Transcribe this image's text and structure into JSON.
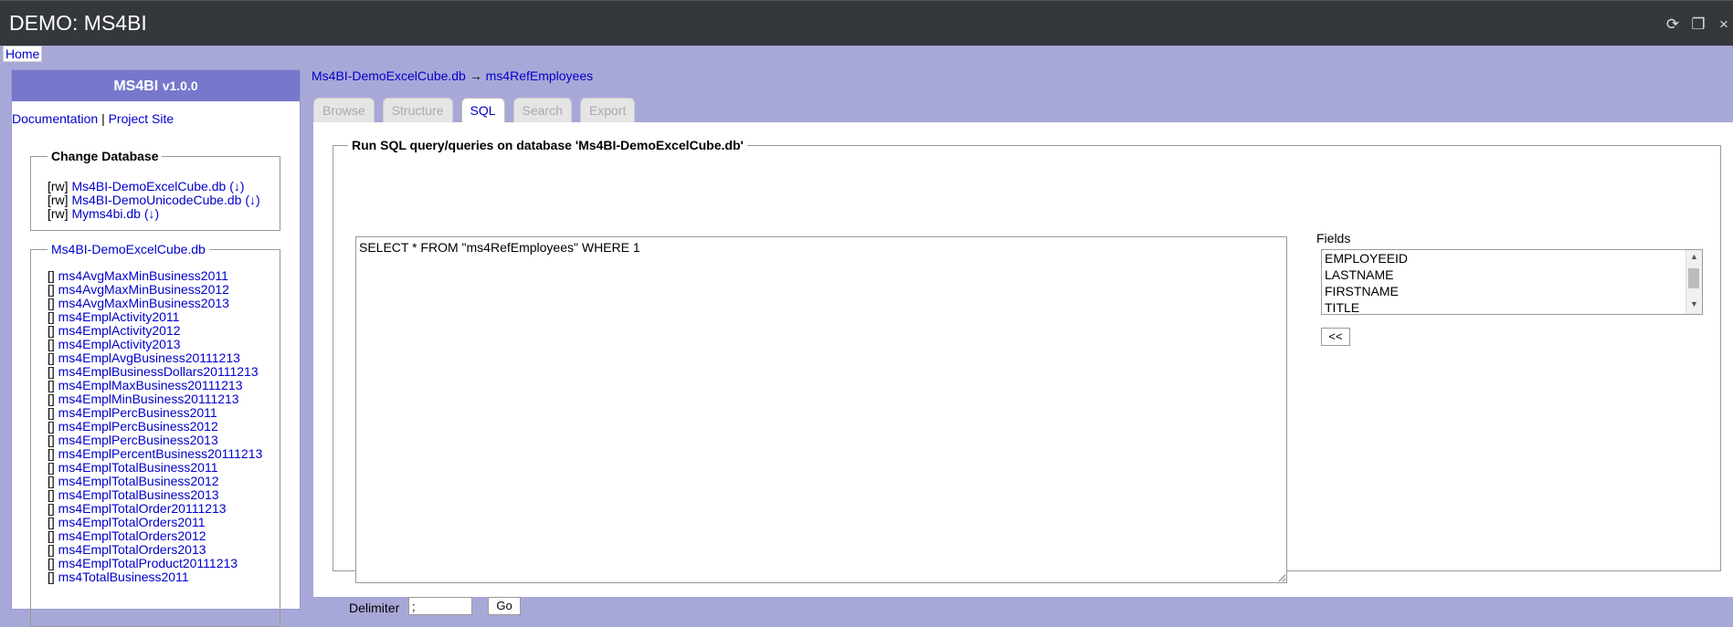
{
  "app": {
    "title": "DEMO: MS4BI",
    "home_label": "Home"
  },
  "sidebar": {
    "title": "MS4BI",
    "version": "v1.0.0",
    "doc_link": "Documentation",
    "separator": "|",
    "project_link": "Project Site",
    "change_db_legend": "Change Database",
    "databases": [
      {
        "mode": "[rw]",
        "name": "Ms4BI-DemoExcelCube.db",
        "download": "(↓)"
      },
      {
        "mode": "[rw]",
        "name": "Ms4BI-DemoUnicodeCube.db",
        "download": "(↓)"
      },
      {
        "mode": "[rw]",
        "name": "Myms4bi.db",
        "download": "(↓)"
      }
    ],
    "current_db": "Ms4BI-DemoExcelCube.db",
    "table_prefix": "[]",
    "tables": [
      "ms4AvgMaxMinBusiness2011",
      "ms4AvgMaxMinBusiness2012",
      "ms4AvgMaxMinBusiness2013",
      "ms4EmplActivity2011",
      "ms4EmplActivity2012",
      "ms4EmplActivity2013",
      "ms4EmplAvgBusiness20111213",
      "ms4EmplBusinessDollars20111213",
      "ms4EmplMaxBusiness20111213",
      "ms4EmplMinBusiness20111213",
      "ms4EmplPercBusiness2011",
      "ms4EmplPercBusiness2012",
      "ms4EmplPercBusiness2013",
      "ms4EmplPercentBusiness20111213",
      "ms4EmplTotalBusiness2011",
      "ms4EmplTotalBusiness2012",
      "ms4EmplTotalBusiness2013",
      "ms4EmplTotalOrder20111213",
      "ms4EmplTotalOrders2011",
      "ms4EmplTotalOrders2012",
      "ms4EmplTotalOrders2013",
      "ms4EmplTotalProduct20111213",
      "ms4TotalBusiness2011"
    ]
  },
  "main": {
    "breadcrumb_db": "Ms4BI-DemoExcelCube.db",
    "breadcrumb_arrow": "→",
    "breadcrumb_table": "ms4RefEmployees",
    "tabs": [
      "Browse",
      "Structure",
      "SQL",
      "Search",
      "Export"
    ],
    "active_tab": "SQL",
    "query_legend": "Run SQL query/queries on database 'Ms4BI-DemoExcelCube.db'",
    "sql_text": "SELECT * FROM \"ms4RefEmployees\" WHERE 1",
    "fields_label": "Fields",
    "fields": [
      "EMPLOYEEID",
      "LASTNAME",
      "FIRSTNAME",
      "TITLE"
    ],
    "add_button": "<<",
    "delimiter_label": "Delimiter",
    "delimiter_value": ";",
    "go_button": "Go"
  }
}
